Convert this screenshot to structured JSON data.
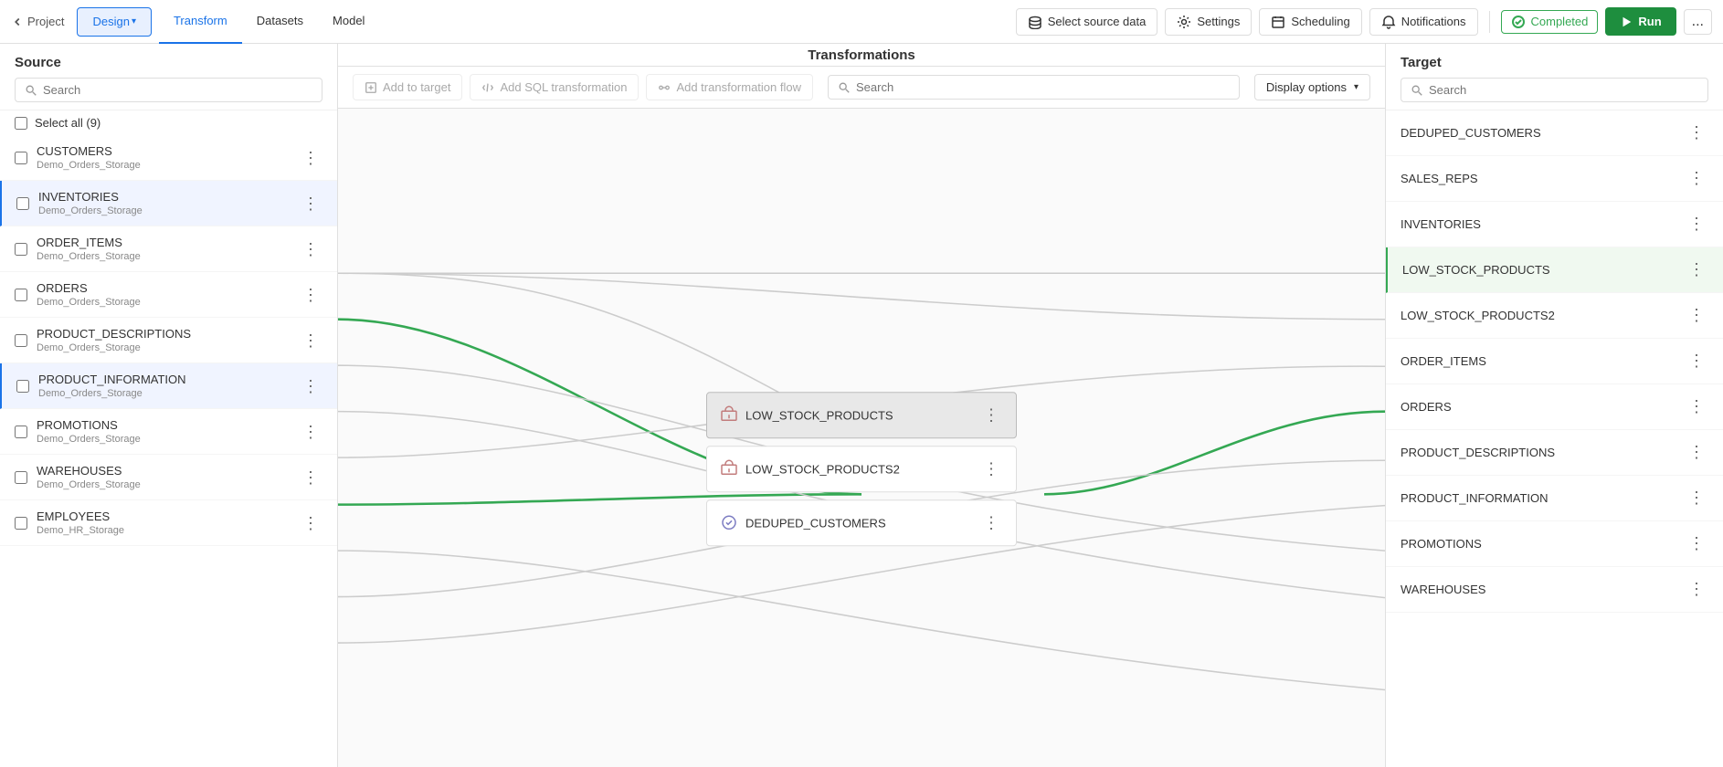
{
  "nav": {
    "back_label": "Project",
    "design_label": "Design",
    "tabs": [
      "Transform",
      "Datasets",
      "Model"
    ],
    "toolbar_buttons": [
      {
        "id": "select-source",
        "label": "Select source data",
        "icon": "database"
      },
      {
        "id": "settings",
        "label": "Settings",
        "icon": "gear"
      },
      {
        "id": "scheduling",
        "label": "Scheduling",
        "icon": "calendar"
      },
      {
        "id": "notifications",
        "label": "Notifications",
        "icon": "bell"
      }
    ],
    "completed_label": "Completed",
    "run_label": "Run",
    "more_label": "..."
  },
  "source": {
    "title": "Source",
    "search_placeholder": "Search",
    "select_all_label": "Select all (9)",
    "items": [
      {
        "name": "CUSTOMERS",
        "sub": "Demo_Orders_Storage",
        "highlighted": false
      },
      {
        "name": "INVENTORIES",
        "sub": "Demo_Orders_Storage",
        "highlighted": true
      },
      {
        "name": "ORDER_ITEMS",
        "sub": "Demo_Orders_Storage",
        "highlighted": false
      },
      {
        "name": "ORDERS",
        "sub": "Demo_Orders_Storage",
        "highlighted": false
      },
      {
        "name": "PRODUCT_DESCRIPTIONS",
        "sub": "Demo_Orders_Storage",
        "highlighted": false
      },
      {
        "name": "PRODUCT_INFORMATION",
        "sub": "Demo_Orders_Storage",
        "highlighted": true
      },
      {
        "name": "PROMOTIONS",
        "sub": "Demo_Orders_Storage",
        "highlighted": false
      },
      {
        "name": "WAREHOUSES",
        "sub": "Demo_Orders_Storage",
        "highlighted": false
      },
      {
        "name": "EMPLOYEES",
        "sub": "Demo_HR_Storage",
        "highlighted": false
      }
    ]
  },
  "transformations": {
    "title": "Transformations",
    "toolbar": {
      "add_to_target": "Add to target",
      "add_sql": "Add SQL transformation",
      "add_flow": "Add transformation flow",
      "search_placeholder": "Search",
      "display_options": "Display options"
    },
    "nodes": [
      {
        "name": "LOW_STOCK_PRODUCTS",
        "active": true,
        "icon": "transform"
      },
      {
        "name": "LOW_STOCK_PRODUCTS2",
        "active": false,
        "icon": "transform"
      },
      {
        "name": "DEDUPED_CUSTOMERS",
        "active": false,
        "icon": "dedup"
      }
    ]
  },
  "target": {
    "title": "Target",
    "search_placeholder": "Search",
    "items": [
      {
        "name": "DEDUPED_CUSTOMERS",
        "highlighted": false
      },
      {
        "name": "SALES_REPS",
        "highlighted": false
      },
      {
        "name": "INVENTORIES",
        "highlighted": false
      },
      {
        "name": "LOW_STOCK_PRODUCTS",
        "highlighted": true
      },
      {
        "name": "LOW_STOCK_PRODUCTS2",
        "highlighted": false
      },
      {
        "name": "ORDER_ITEMS",
        "highlighted": false
      },
      {
        "name": "ORDERS",
        "highlighted": false
      },
      {
        "name": "PRODUCT_DESCRIPTIONS",
        "highlighted": false
      },
      {
        "name": "PRODUCT_INFORMATION",
        "highlighted": false
      },
      {
        "name": "PROMOTIONS",
        "highlighted": false
      },
      {
        "name": "WAREHOUSES",
        "highlighted": false
      }
    ]
  },
  "colors": {
    "green": "#34a853",
    "blue": "#1a73e8",
    "active_border": "#34a853"
  }
}
